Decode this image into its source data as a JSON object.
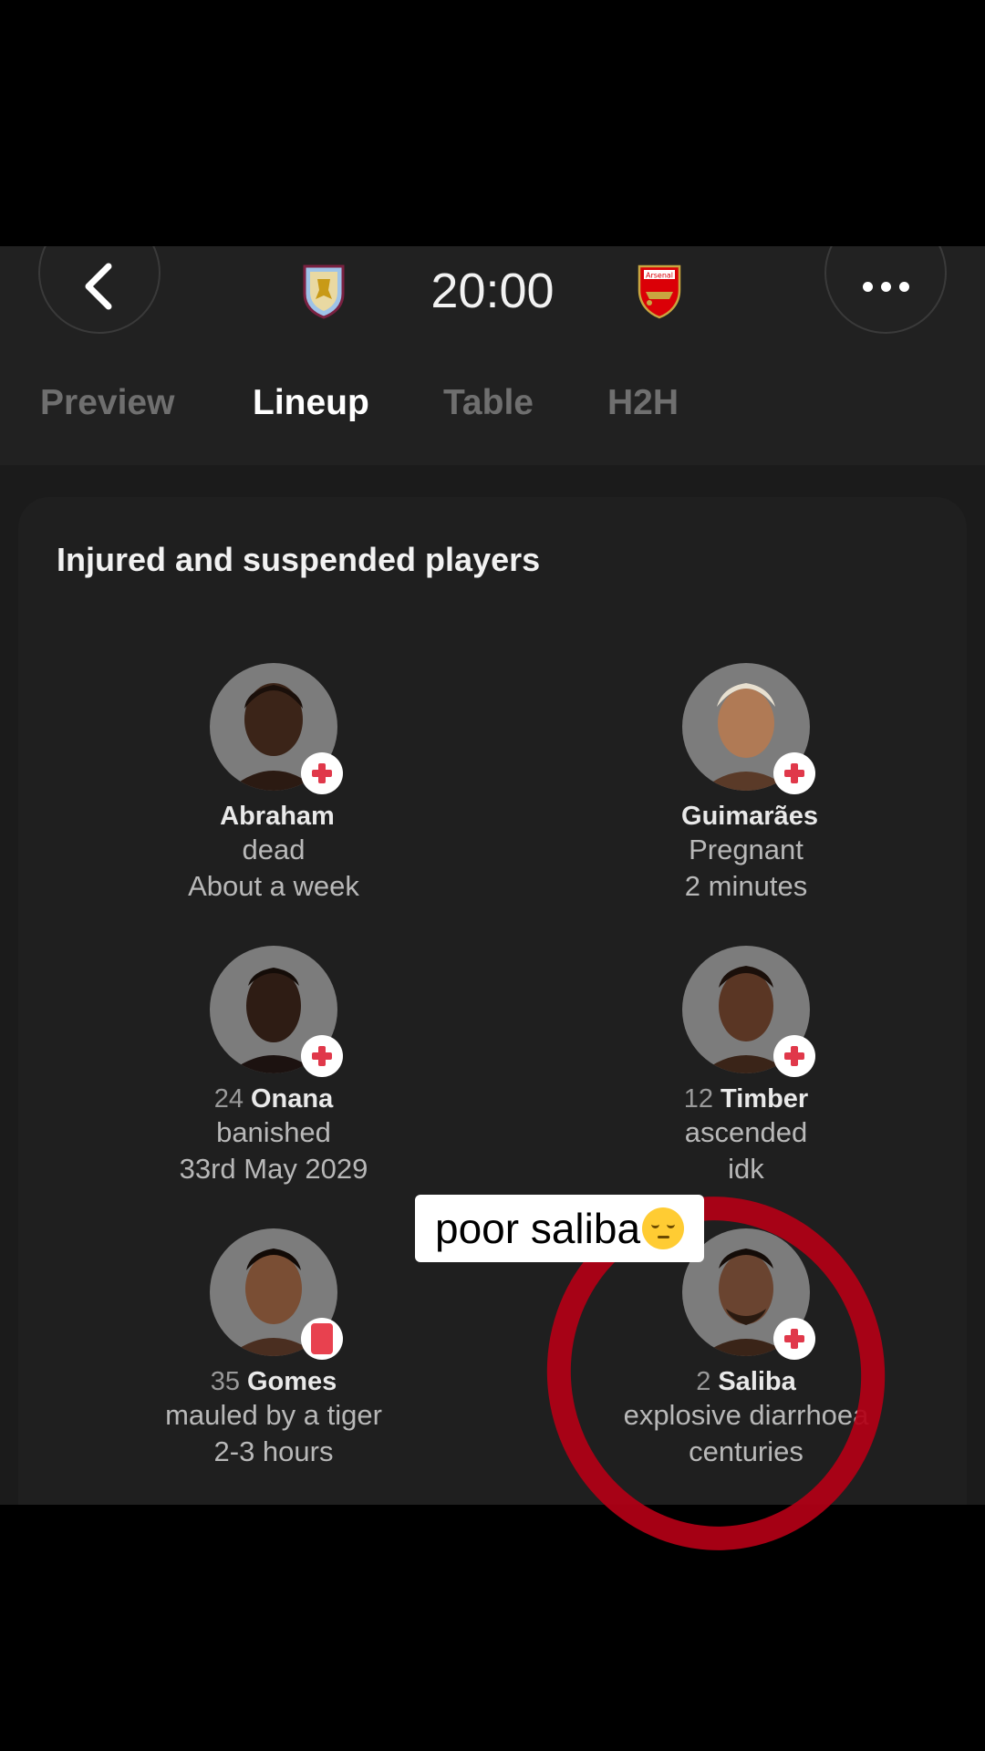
{
  "header": {
    "kickoff_time": "20:00",
    "home_crest": "aston-villa-crest",
    "away_crest": "arsenal-crest",
    "away_crest_text": "Arsenal"
  },
  "tabs": [
    {
      "label": "Preview",
      "active": false
    },
    {
      "label": "Lineup",
      "active": true
    },
    {
      "label": "Table",
      "active": false
    },
    {
      "label": "H2H",
      "active": false
    }
  ],
  "section": {
    "title": "Injured and suspended players"
  },
  "players": [
    {
      "number": "",
      "name": "Abraham",
      "reason": "dead",
      "duration": "About a week",
      "status": "injury"
    },
    {
      "number": "",
      "name": "Guimarães",
      "reason": "Pregnant",
      "duration": "2 minutes",
      "status": "injury"
    },
    {
      "number": "24",
      "name": "Onana",
      "reason": "banished",
      "duration": "33rd May 2029",
      "status": "injury"
    },
    {
      "number": "12",
      "name": "Timber",
      "reason": "ascended",
      "duration": "idk",
      "status": "injury"
    },
    {
      "number": "35",
      "name": "Gomes",
      "reason": "mauled by a tiger",
      "duration": "2-3 hours",
      "status": "red-card"
    },
    {
      "number": "2",
      "name": "Saliba",
      "reason": "explosive diarrhoea",
      "duration": "centuries",
      "status": "injury"
    }
  ],
  "overlay": {
    "caption": "poor saliba",
    "caption_emoji": "pensive-face-emoji",
    "highlight_color": "#b10015"
  },
  "colors": {
    "background": "#1b1b1b",
    "injury_red": "#e0384a"
  }
}
